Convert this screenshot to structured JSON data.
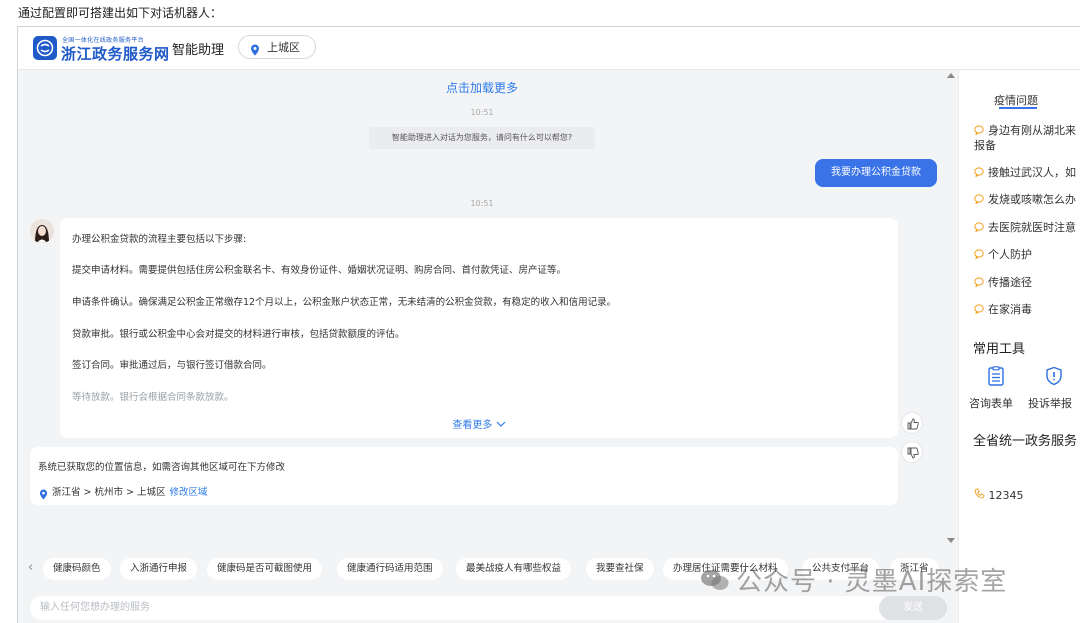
{
  "caption": "通过配置即可搭建出如下对话机器人：",
  "header": {
    "logo_small": "全国一体化在线政务服务平台",
    "logo_big": "浙江政务服务网",
    "app_title": "智能助理",
    "region": "上城区"
  },
  "chat": {
    "load_more": "点击加载更多",
    "time1": "10:51",
    "system_message": "智能助理进入对话为您服务，请问有什么可以帮您?",
    "user_message": "我要办理公积金贷款",
    "time2": "10:51",
    "bot_lines": [
      "办理公积金贷款的流程主要包括以下步骤:",
      "提交申请材料。需要提供包括住房公积金联名卡、有效身份证件、婚姻状况证明、购房合同、首付款凭证、房产证等。",
      "申请条件确认。确保满足公积金正常缴存12个月以上，公积金账户状态正常，无未结清的公积金贷款，有稳定的收入和信用记录。",
      "贷款审批。银行或公积金中心会对提交的材料进行审核，包括贷款额度的评估。",
      "签订合同。审批通过后，与银行签订借款合同。",
      "等待放款。银行会根据合同条款放款。"
    ],
    "see_more": "查看更多",
    "location_message": "系统已获取您的位置信息，如需咨询其他区域可在下方修改",
    "location_path": "浙江省 > 杭州市 > 上城区",
    "modify_region": "修改区域"
  },
  "right_panel": {
    "tab": "疫情问题",
    "faq": [
      "身边有刚从湖北来",
      "报备",
      "接触过武汉人，如",
      "发烧或咳嗽怎么办",
      "去医院就医时注意",
      "个人防护",
      "传播途径",
      "在家消毒"
    ],
    "tools_title": "常用工具",
    "tools": [
      "咨询表单",
      "投诉举报"
    ],
    "hotline_title": "全省统一政务服务",
    "hotline": "12345"
  },
  "quick_chips": [
    "健康码颜色",
    "入浙通行申报",
    "健康码是否可截图使用",
    "健康通行码适用范围",
    "最美战疫人有哪些权益",
    "我要查社保",
    "办理居住证需要什么材料",
    "公共支付平台",
    "浙江省"
  ],
  "input": {
    "placeholder": "输入任何您想办理的服务",
    "send": "发送"
  },
  "watermark": "公众号 · 灵墨AI探索室",
  "colors": {
    "accent": "#3a73e8",
    "link": "#2f7be9",
    "brand": "#1f5ac8",
    "chat_bg": "#f3f4f6",
    "faq_icon": "#f0a020"
  }
}
